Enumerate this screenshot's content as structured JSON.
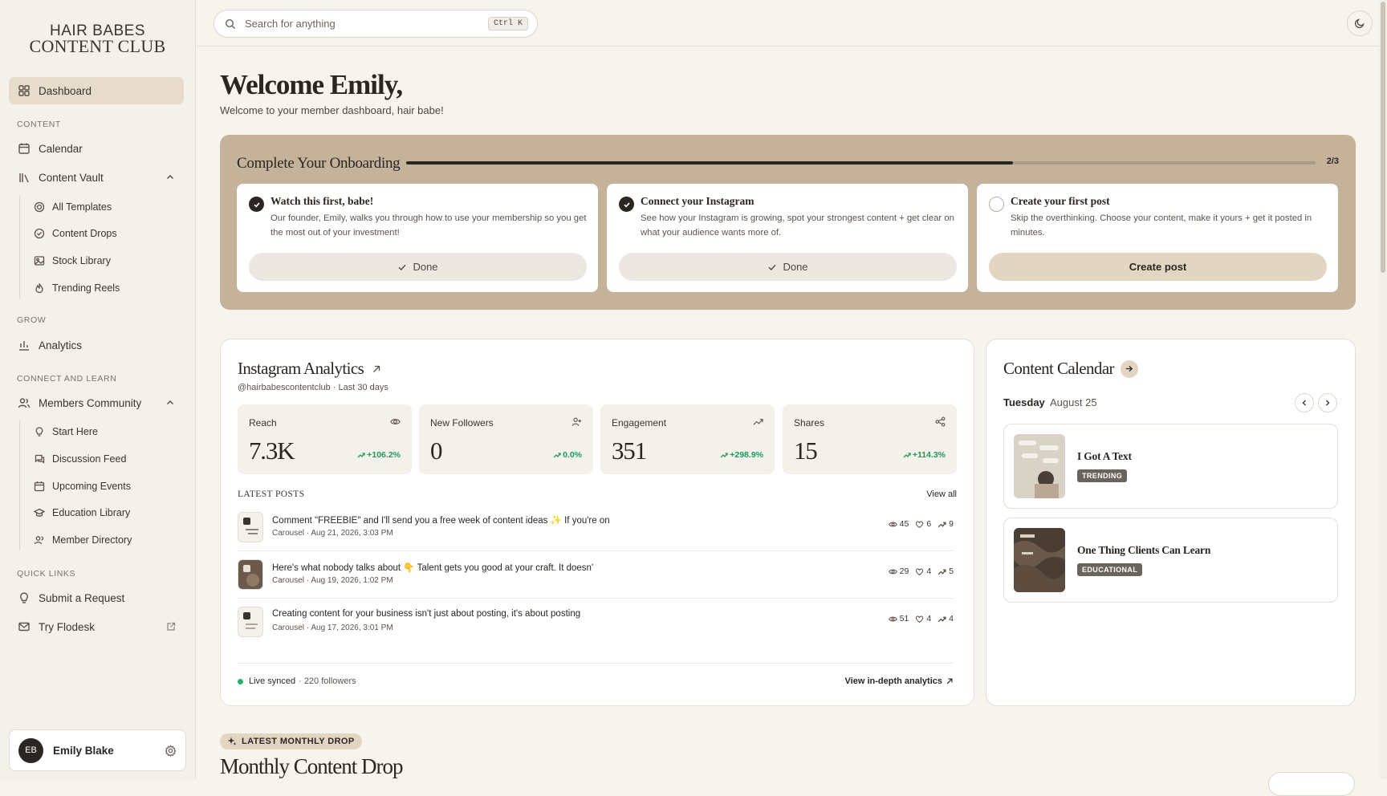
{
  "brand": {
    "line1": "HAIR BABES",
    "line2": "CONTENT CLUB"
  },
  "sidebar": {
    "dashboard": "Dashboard",
    "sections": {
      "content": "CONTENT",
      "grow": "GROW",
      "connect": "CONNECT AND LEARN",
      "quick": "QUICK LINKS"
    },
    "calendar": "Calendar",
    "content_vault": "Content Vault",
    "vault_items": [
      "All Templates",
      "Content Drops",
      "Stock Library",
      "Trending Reels"
    ],
    "analytics": "Analytics",
    "members_community": "Members Community",
    "community_items": [
      "Start Here",
      "Discussion Feed",
      "Upcoming Events",
      "Education Library",
      "Member Directory"
    ],
    "submit_request": "Submit a Request",
    "try_flodesk": "Try Flodesk"
  },
  "user": {
    "initials": "EB",
    "name": "Emily Blake"
  },
  "search": {
    "placeholder": "Search for anything",
    "shortcut": "Ctrl K"
  },
  "welcome": {
    "title": "Welcome Emily,",
    "subtitle": "Welcome to your member dashboard, hair babe!"
  },
  "onboarding": {
    "title": "Complete Your Onboarding",
    "progress_text": "2/3",
    "progress_fraction": 0.667,
    "cards": [
      {
        "title": "Watch this first, babe!",
        "desc": "Our founder, Emily, walks you through how to use your membership so you get the most out of your investment!",
        "button": "Done",
        "done": true
      },
      {
        "title": "Connect your Instagram",
        "desc": "See how your Instagram is growing, spot your strongest content + get clear on what your audience wants more of.",
        "button": "Done",
        "done": true
      },
      {
        "title": "Create your first post",
        "desc": "Skip the overthinking. Choose your content, make it yours + get it posted in minutes.",
        "button": "Create post",
        "done": false
      }
    ]
  },
  "analytics": {
    "title": "Instagram Analytics",
    "subtitle": "@hairbabescontentclub · Last 30 days",
    "metrics": [
      {
        "label": "Reach",
        "value": "7.3K",
        "trend": "+106.2%",
        "icon": "eye-icon"
      },
      {
        "label": "New Followers",
        "value": "0",
        "trend": "0.0%",
        "icon": "user-plus-icon"
      },
      {
        "label": "Engagement",
        "value": "351",
        "trend": "+298.9%",
        "icon": "trending-up-icon"
      },
      {
        "label": "Shares",
        "value": "15",
        "trend": "+114.3%",
        "icon": "share-icon"
      }
    ],
    "latest_posts_label": "LATEST POSTS",
    "view_all": "View all",
    "posts": [
      {
        "title": "Comment \"FREEBIE\" and I'll send you a free week of content ideas ✨ If you're on",
        "meta": "Carousel · Aug 21, 2026, 3:03 PM",
        "views": "45",
        "likes": "6",
        "shares": "9"
      },
      {
        "title": "Here's what nobody talks about 👇 Talent gets you good at your craft. It doesn'",
        "meta": "Carousel · Aug 19, 2026, 1:02 PM",
        "views": "29",
        "likes": "4",
        "shares": "5"
      },
      {
        "title": "Creating content for your business isn't just about posting, it's about posting",
        "meta": "Carousel · Aug 17, 2026, 3:01 PM",
        "views": "51",
        "likes": "4",
        "shares": "4"
      }
    ],
    "live_synced": "Live synced",
    "followers": "· 220 followers",
    "in_depth": "View in-depth analytics"
  },
  "calendar": {
    "title": "Content Calendar",
    "day": "Tuesday",
    "date": "August 25",
    "items": [
      {
        "title": "I Got A Text",
        "badge": "TRENDING"
      },
      {
        "title": "One Thing Clients Can Learn",
        "badge": "EDUCATIONAL"
      }
    ]
  },
  "monthly_drop": {
    "badge": "LATEST MONTHLY DROP",
    "title": "Monthly Content Drop"
  },
  "colors": {
    "accent": "#c5b29a",
    "positive": "#1d9a5c",
    "live": "#22b36b"
  }
}
